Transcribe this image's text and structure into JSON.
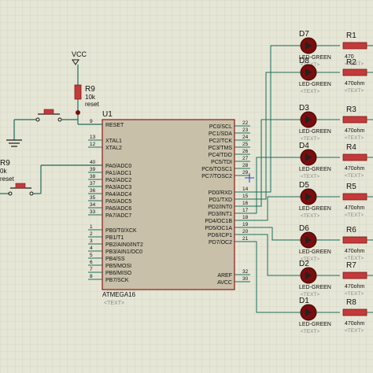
{
  "colors": {
    "background": "#e6e6d6",
    "grid": "#d2d2c2",
    "wire": "#1a6e5a",
    "chip_body": "#c8c0a8",
    "chip_border": "#8a1a1a",
    "led_body": "#7a0d0d",
    "resistor": "#c43a3a",
    "text": "#111111",
    "placeholder_text": "#8a8a8a"
  },
  "power": {
    "vcc_label": "VCC"
  },
  "reset_network": {
    "resistor_name": "R9",
    "resistor_value": "10k",
    "resistor_net": "reset",
    "left_resistor_name": "R9",
    "left_resistor_value": "0k",
    "left_resistor_net": "reset"
  },
  "mcu": {
    "ref": "U1",
    "part": "ATMEGA16",
    "text_placeholder": "<TEXT>",
    "left_pins": [
      {
        "name": "RESET",
        "num": "9"
      },
      {
        "name": "XTAL1",
        "num": "13"
      },
      {
        "name": "XTAL2",
        "num": "12"
      },
      {
        "name": "PA0/ADC0",
        "num": "40"
      },
      {
        "name": "PA1/ADC1",
        "num": "39"
      },
      {
        "name": "PA2/ADC2",
        "num": "38"
      },
      {
        "name": "PA3/ADC3",
        "num": "37"
      },
      {
        "name": "PA4/ADC4",
        "num": "36"
      },
      {
        "name": "PA5/ADC5",
        "num": "35"
      },
      {
        "name": "PA6/ADC6",
        "num": "34"
      },
      {
        "name": "PA7/ADC7",
        "num": "33"
      },
      {
        "name": "PB0/T0/XCK",
        "num": "1"
      },
      {
        "name": "PB1/T1",
        "num": "2"
      },
      {
        "name": "PB2/AIN0/INT2",
        "num": "3"
      },
      {
        "name": "PB3/AIN1/OC0",
        "num": "4"
      },
      {
        "name": "PB4/SS",
        "num": "5"
      },
      {
        "name": "PB5/MOSI",
        "num": "6"
      },
      {
        "name": "PB6/MISO",
        "num": "7"
      },
      {
        "name": "PB7/SCK",
        "num": "8"
      }
    ],
    "right_pins": [
      {
        "name": "PC0/SCL",
        "num": "22"
      },
      {
        "name": "PC1/SDA",
        "num": "23"
      },
      {
        "name": "PC2/TCK",
        "num": "24"
      },
      {
        "name": "PC3/TMS",
        "num": "25"
      },
      {
        "name": "PC4/TDO",
        "num": "26"
      },
      {
        "name": "PC5/TDI",
        "num": "27"
      },
      {
        "name": "PC6/TOSC1",
        "num": "28"
      },
      {
        "name": "PC7/TOSC2",
        "num": "29"
      },
      {
        "name": "PD0/RXD",
        "num": "14"
      },
      {
        "name": "PD1/TXD",
        "num": "15"
      },
      {
        "name": "PD2/INT0",
        "num": "16"
      },
      {
        "name": "PD3/INT1",
        "num": "17"
      },
      {
        "name": "PD4/OC1B",
        "num": "18"
      },
      {
        "name": "PD5/OC1A",
        "num": "19"
      },
      {
        "name": "PD6/ICP1",
        "num": "20"
      },
      {
        "name": "PD7/OC2",
        "num": "21"
      },
      {
        "name": "AREF",
        "num": "32"
      },
      {
        "name": "AVCC",
        "num": "30"
      }
    ]
  },
  "leds": [
    {
      "ref": "D7",
      "part": "LED-GREEN",
      "text": "<TEXT>"
    },
    {
      "ref": "D8",
      "part": "LED-GREEN",
      "text": "<TEXT>"
    },
    {
      "ref": "D3",
      "part": "LED-GREEN",
      "text": "<TEXT>"
    },
    {
      "ref": "D4",
      "part": "LED-GREEN",
      "text": "<TEXT>"
    },
    {
      "ref": "D5",
      "part": "LED-GREEN",
      "text": "<TEXT>"
    },
    {
      "ref": "D6",
      "part": "LED-GREEN",
      "text": "<TEXT>"
    },
    {
      "ref": "D2",
      "part": "LED-GREEN",
      "text": "<TEXT>"
    },
    {
      "ref": "D1",
      "part": "LED-GREEN",
      "text": "<TEXT>"
    }
  ],
  "resistors": [
    {
      "ref": "R1",
      "value": "470",
      "text": "<TEXT>"
    },
    {
      "ref": "R2",
      "value": "470ohm",
      "text": "<TEXT>"
    },
    {
      "ref": "R3",
      "value": "470ohm",
      "text": "<TEXT>"
    },
    {
      "ref": "R4",
      "value": "470ohm",
      "text": "<TEXT>"
    },
    {
      "ref": "R5",
      "value": "470ohm",
      "text": "<TEXT>"
    },
    {
      "ref": "R6",
      "value": "470ohm",
      "text": "<TEXT>"
    },
    {
      "ref": "R7",
      "value": "470ohm",
      "text": "<TEXT>"
    },
    {
      "ref": "R8",
      "value": "470ohm",
      "text": "<TEXT>"
    }
  ]
}
